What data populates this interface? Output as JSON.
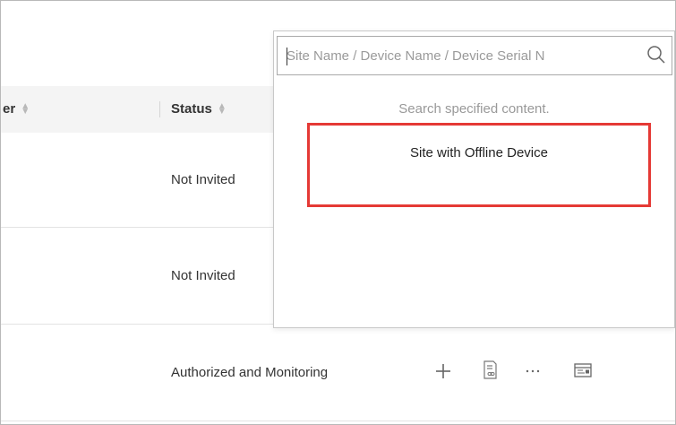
{
  "table": {
    "columns": [
      {
        "label": "er",
        "sort_icon": "sort-arrows-icon"
      },
      {
        "label": "Status",
        "sort_icon": "sort-arrows-icon"
      }
    ],
    "rows": [
      {
        "status": "Not Invited"
      },
      {
        "status": "Not Invited"
      },
      {
        "status": "Authorized and Monitoring",
        "actions": [
          "plus-icon",
          "link-document-icon",
          "more-icon",
          "device-config-icon"
        ]
      }
    ]
  },
  "search": {
    "placeholder": "Site Name / Device Name / Device Serial N",
    "value": "",
    "icon": "search-icon",
    "hint": "Search specified content.",
    "suggestions": [
      "Site with Offline Device"
    ]
  },
  "colors": {
    "highlight": "#e53935",
    "header_bg": "#f4f4f4",
    "muted_text": "#999999"
  }
}
